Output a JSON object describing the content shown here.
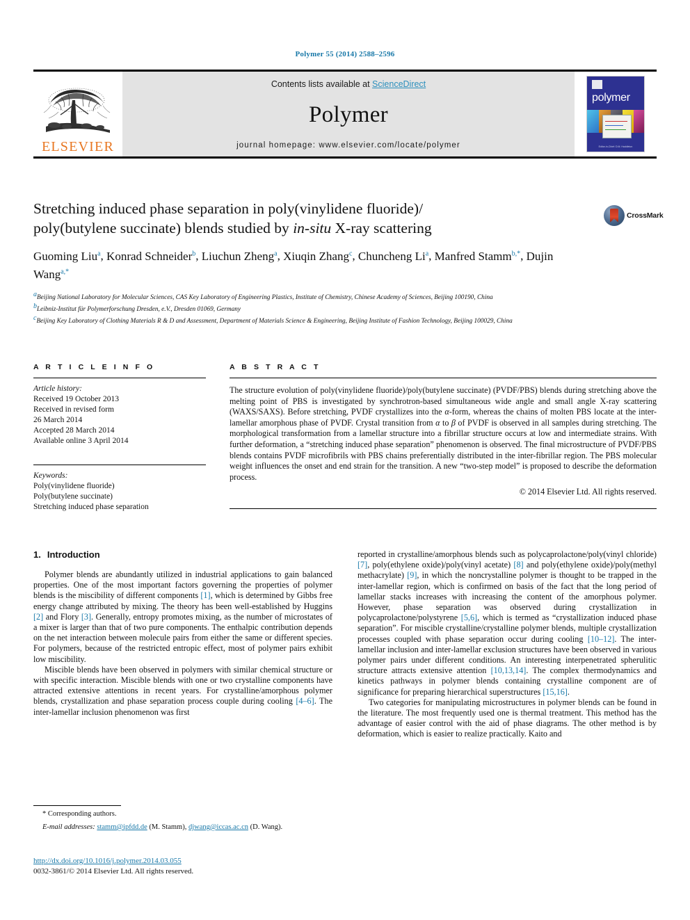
{
  "running_head": "Polymer 55 (2014) 2588–2596",
  "masthead": {
    "publisher_logo_label": "ELSEVIER",
    "contents_prefix": "Contents lists available at ",
    "contents_link": "ScienceDirect",
    "journal_title": "Polymer",
    "homepage_line": "journal homepage: www.elsevier.com/locate/polymer",
    "cover_word": "polymer",
    "cover_footer": "Editor-in-Chief: D.M. Haddleton"
  },
  "article": {
    "title_line1": "Stretching induced phase separation in poly(vinylidene fluoride)/",
    "title_line2_a": "poly(butylene succinate) blends studied by ",
    "title_line2_italic": "in-situ",
    "title_line2_b": " X-ray scattering",
    "crossmark_label": "CrossMark",
    "authors": [
      {
        "name": "Guoming Liu",
        "sup": "a",
        "sep": ", "
      },
      {
        "name": "Konrad Schneider",
        "sup": "b",
        "sep": ", "
      },
      {
        "name": "Liuchun Zheng",
        "sup": "a",
        "sep": ", "
      },
      {
        "name": "Xiuqin Zhang",
        "sup": "c",
        "sep": ", "
      },
      {
        "name": "Chuncheng Li",
        "sup": "a",
        "sep": ", "
      },
      {
        "name": "Manfred Stamm",
        "sup": "b,*",
        "sep": ", "
      },
      {
        "name": "Dujin Wang",
        "sup": "a,*",
        "sep": ""
      }
    ],
    "affiliations": [
      {
        "mark": "a",
        "text": "Beijing National Laboratory for Molecular Sciences, CAS Key Laboratory of Engineering Plastics, Institute of Chemistry, Chinese Academy of Sciences, Beijing 100190, China"
      },
      {
        "mark": "b",
        "text": "Leibniz-Institut für Polymerforschung Dresden, e.V., Dresden 01069, Germany"
      },
      {
        "mark": "c",
        "text": "Beijing Key Laboratory of Clothing Materials R & D and Assessment, Department of Materials Science & Engineering, Beijing Institute of Fashion Technology, Beijing 100029, China"
      }
    ]
  },
  "article_info": {
    "heading": "A R T I C L E   I N F O",
    "history_label": "Article history:",
    "history": [
      "Received 19 October 2013",
      "Received in revised form",
      "26 March 2014",
      "Accepted 28 March 2014",
      "Available online 3 April 2014"
    ],
    "keywords_label": "Keywords:",
    "keywords": [
      "Poly(vinylidene fluoride)",
      "Poly(butylene succinate)",
      "Stretching induced phase separation"
    ]
  },
  "abstract": {
    "heading": "A B S T R A C T",
    "part1": "The structure evolution of poly(vinylidene fluoride)/poly(butylene succinate) (PVDF/PBS) blends during stretching above the melting point of PBS is investigated by synchrotron-based simultaneous wide angle and small angle X-ray scattering (WAXS/SAXS). Before stretching, PVDF crystallizes into the ",
    "alpha1": "α",
    "part2": "-form, whereas the chains of molten PBS locate at the inter-lamellar amorphous phase of PVDF. Crystal transition from ",
    "alpha2": "α",
    "part3": " to ",
    "beta1": "β",
    "part4": " of PVDF is observed in all samples during stretching. The morphological transformation from a lamellar structure into a fibrillar structure occurs at low and intermediate strains. With further deformation, a “stretching induced phase separation” phenomenon is observed. The final microstructure of PVDF/PBS blends contains PVDF microfibrils with PBS chains preferentially distributed in the inter-fibrillar region. The PBS molecular weight influences the onset and end strain for the transition. A new “two-step model” is proposed to describe the deformation process.",
    "copyright": "© 2014 Elsevier Ltd. All rights reserved."
  },
  "section": {
    "number": "1.",
    "title": "Introduction"
  },
  "body": {
    "left": [
      "Polymer blends are abundantly utilized in industrial applications to gain balanced properties. One of the most important factors governing the properties of polymer blends is the miscibility of different components [1], which is determined by Gibbs free energy change attributed by mixing. The theory has been well-established by Huggins [2] and Flory [3]. Generally, entropy promotes mixing, as the number of microstates of a mixer is larger than that of two pure components. The enthalpic contribution depends on the net interaction between molecule pairs from either the same or different species. For polymers, because of the restricted entropic effect, most of polymer pairs exhibit low miscibility.",
      "Miscible blends have been observed in polymers with similar chemical structure or with specific interaction. Miscible blends with one or two crystalline components have attracted extensive attentions in recent years. For crystalline/amorphous polymer blends, crystallization and phase separation process couple during cooling [4–6]. The inter-lamellar inclusion phenomenon was first"
    ],
    "right": [
      "reported in crystalline/amorphous blends such as polycaprolactone/poly(vinyl chloride) [7], poly(ethylene oxide)/poly(vinyl acetate) [8] and poly(ethylene oxide)/poly(methyl methacrylate) [9], in which the noncrystalline polymer is thought to be trapped in the inter-lamellar region, which is confirmed on basis of the fact that the long period of lamellar stacks increases with increasing the content of the amorphous polymer. However, phase separation was observed during crystallization in polycaprolactone/polystyrene [5,6], which is termed as “crystallization induced phase separation”. For miscible crystalline/crystalline polymer blends, multiple crystallization processes coupled with phase separation occur during cooling [10–12]. The inter-lamellar inclusion and inter-lamellar exclusion structures have been observed in various polymer pairs under different conditions. An interesting interpenetrated spherulitic structure attracts extensive attention [10,13,14]. The complex thermodynamics and kinetics pathways in polymer blends containing crystalline component are of significance for preparing hierarchical superstructures [15,16].",
      "Two categories for manipulating microstructures in polymer blends can be found in the literature. The most frequently used one is thermal treatment. This method has the advantage of easier control with the aid of phase diagrams. The other method is by deformation, which is easier to realize practically. Kaito and"
    ]
  },
  "footnote": {
    "corresponding": "* Corresponding authors.",
    "email_label": "E-mail addresses:",
    "email1": "stamm@ipfdd.de",
    "email1_name": " (M. Stamm), ",
    "email2": "djwang@iccas.ac.cn",
    "email2_name": " (D. Wang)."
  },
  "footer": {
    "doi": "http://dx.doi.org/10.1016/j.polymer.2014.03.055",
    "issn": "0032-3861/© 2014 Elsevier Ltd. All rights reserved."
  },
  "colors": {
    "link": "#1878a8",
    "elsevier_orange": "#E87722",
    "masthead_bg": "#e3e3e3",
    "cover_blue": "#2d3191"
  }
}
